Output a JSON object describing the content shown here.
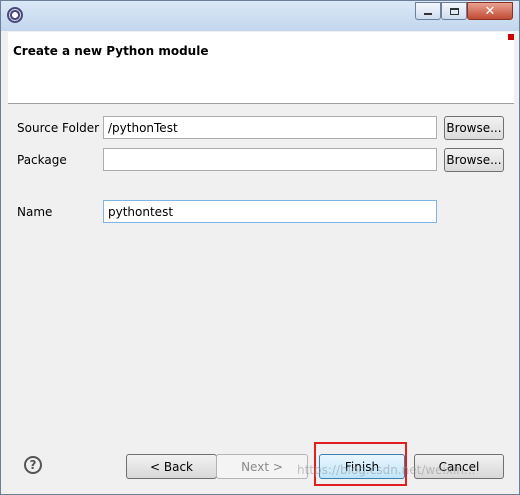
{
  "window": {
    "icon": "eclipse-icon",
    "controls": {
      "minimize": "minimize-icon",
      "maximize": "maximize-icon",
      "close": "close-icon",
      "close_color": "#c14a33"
    }
  },
  "header": {
    "title": "Create a new Python module",
    "marker_color": "#d00000"
  },
  "form": {
    "source_folder": {
      "label": "Source Folder",
      "value": "/pythonTest",
      "browse_label": "Browse..."
    },
    "package": {
      "label": "Package",
      "value": "",
      "browse_label": "Browse..."
    },
    "name": {
      "label": "Name",
      "value": "pythontest"
    }
  },
  "footer": {
    "help_icon": "help-icon",
    "help_glyph": "?",
    "back_label": "< Back",
    "next_label": "Next >",
    "finish_label": "Finish",
    "cancel_label": "Cancel",
    "highlight_color": "#e02020",
    "watermark": "https://blog.csdn.net/weixin..."
  }
}
